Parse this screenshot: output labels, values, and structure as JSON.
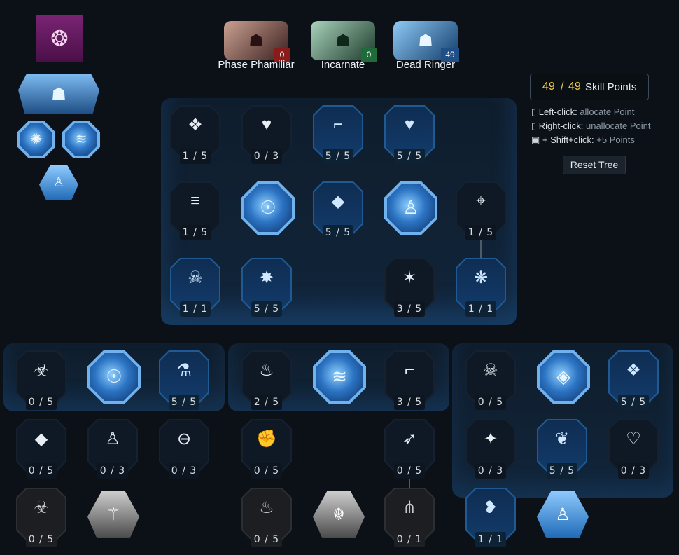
{
  "class_icon": {
    "name": "claw-mark-icon",
    "color": "#6b1d66"
  },
  "specializations": [
    {
      "name": "Phase Phamiliar",
      "points": "0",
      "badge_color": "#8a1b1b",
      "art": "tiger-portrait-icon"
    },
    {
      "name": "Incarnate",
      "points": "0",
      "badge_color": "#1f6b3a",
      "art": "serpent-portrait-icon"
    },
    {
      "name": "Dead Ringer",
      "points": "49",
      "badge_color": "#1f4f86",
      "art": "spectral-portrait-icon"
    }
  ],
  "skill_points": {
    "current": "49",
    "separator": "/",
    "total": "49",
    "label": "Skill Points"
  },
  "help": [
    {
      "key": "Left-click:",
      "text": "allocate Point",
      "icon": "mouse-left-icon"
    },
    {
      "key": "Right-click:",
      "text": "unallocate Point",
      "icon": "mouse-right-icon"
    },
    {
      "key": "+ Shift+click:",
      "text": "+5 Points",
      "icon": "shift-key-icon"
    }
  ],
  "reset_label": "Reset Tree",
  "nodes": {
    "m1": "1 / 5",
    "m2": "0 / 3",
    "m3": "5 / 5",
    "m4": "5 / 5",
    "m5": "1 / 5",
    "m7": "5 / 5",
    "m9": "1 / 5",
    "m10": "1 / 1",
    "m11": "5 / 5",
    "m13": "3 / 5",
    "m14": "1 / 1",
    "l1": "0 / 5",
    "l3": "5 / 5",
    "l4": "0 / 5",
    "l5": "0 / 3",
    "l6": "0 / 3",
    "l7": "0 / 5",
    "c1": "2 / 5",
    "c3": "3 / 5",
    "c4": "0 / 5",
    "c6": "0 / 5",
    "c7": "0 / 5",
    "c9": "0 / 1",
    "r1": "0 / 5",
    "r3": "5 / 5",
    "r4": "0 / 3",
    "r5": "5 / 5",
    "r6": "0 / 3",
    "r7": "1 / 1"
  }
}
